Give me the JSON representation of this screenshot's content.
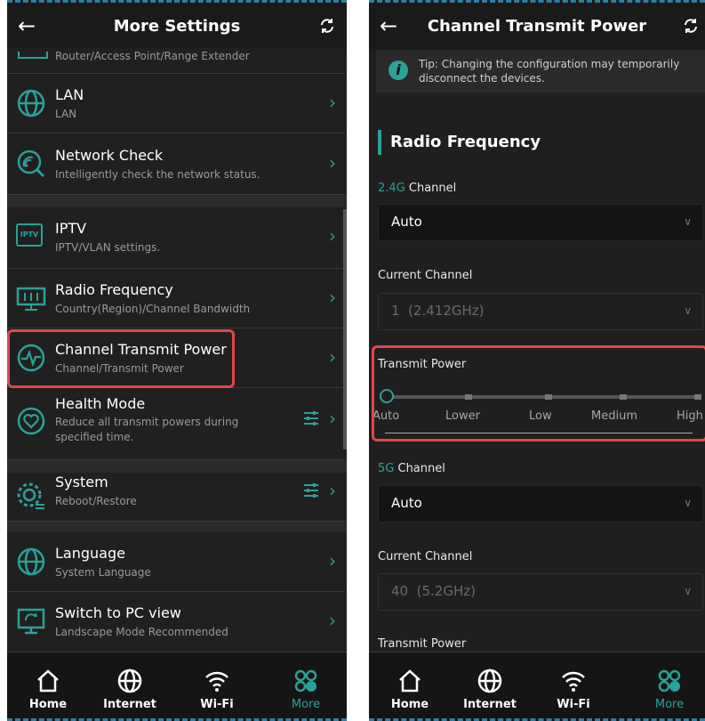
{
  "left": {
    "header": {
      "title": "More Settings"
    },
    "partial_item": {
      "subtitle": "Router/Access Point/Range Extender"
    },
    "items": [
      {
        "title": "LAN",
        "subtitle": "LAN"
      },
      {
        "title": "Network Check",
        "subtitle": "Intelligently check the network status."
      },
      {
        "title": "IPTV",
        "subtitle": "IPTV/VLAN settings."
      },
      {
        "title": "Radio Frequency",
        "subtitle": "Country(Region)/Channel Bandwidth"
      },
      {
        "title": "Channel Transmit Power",
        "subtitle": "Channel/Transmit Power"
      },
      {
        "title": "Health Mode",
        "subtitle": "Reduce all transmit powers during specified time."
      },
      {
        "title": "System",
        "subtitle": "Reboot/Restore"
      },
      {
        "title": "Language",
        "subtitle": "System Language"
      },
      {
        "title": "Switch to PC view",
        "subtitle": "Landscape Mode Recommended"
      }
    ],
    "iptv_badge": "IPTV"
  },
  "right": {
    "header": {
      "title": "Channel Transmit Power"
    },
    "tip": "Tip: Changing the configuration may temporarily disconnect the devices.",
    "section_title": "Radio Frequency",
    "ch24": {
      "label_accent": "2.4G",
      "label_rest": " Channel",
      "value": "Auto"
    },
    "current24": {
      "label": "Current Channel",
      "value": "1  (2.412GHz)"
    },
    "power24": {
      "label": "Transmit Power",
      "levels": [
        "Auto",
        "Lower",
        "Low",
        "Medium",
        "High"
      ],
      "selected_index": 0
    },
    "ch5": {
      "label_accent": "5G",
      "label_rest": " Channel",
      "value": "Auto"
    },
    "current5": {
      "label": "Current Channel",
      "value": "40  (5.2GHz)"
    },
    "power5": {
      "label": "Transmit Power"
    }
  },
  "tabbar": {
    "tabs": [
      "Home",
      "Internet",
      "Wi-Fi",
      "More"
    ],
    "active": "More"
  },
  "colors": {
    "accent": "#2aa199",
    "highlight": "#e04848",
    "background": "#1f1f1f"
  }
}
